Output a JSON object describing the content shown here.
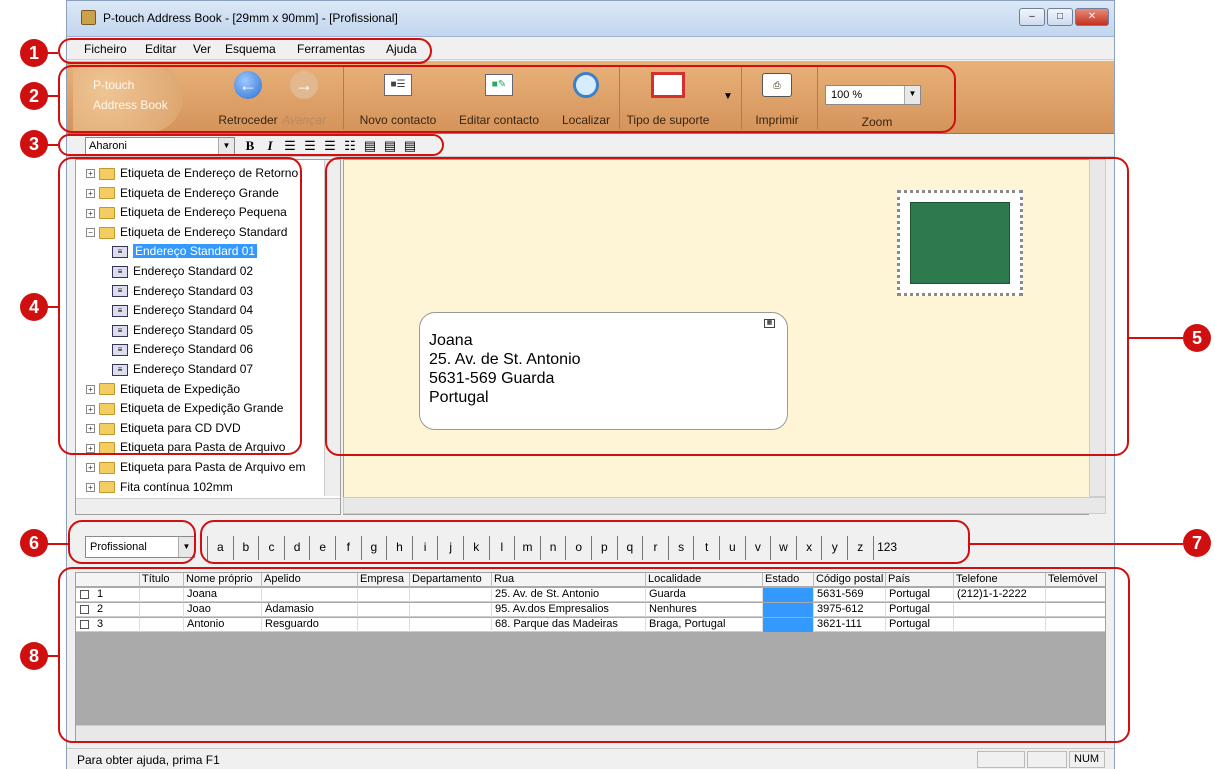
{
  "window": {
    "title": "P-touch Address Book - [29mm x 90mm] - [Profissional]",
    "controls": {
      "minimize": "‒",
      "maximize": "□",
      "close": "✕"
    }
  },
  "menu": [
    "Ficheiro",
    "Editar",
    "Ver",
    "Esquema",
    "Ferramentas",
    "Ajuda"
  ],
  "toolbar": {
    "logo_line1": "P-touch",
    "logo_line2": "Address Book",
    "back": "Retroceder",
    "forward": "Avançar",
    "new_contact": "Novo contacto",
    "edit_contact": "Editar contacto",
    "find": "Localizar",
    "media_type": "Tipo de suporte",
    "print": "Imprimir",
    "zoom_label": "Zoom",
    "zoom_value": "100 %"
  },
  "format_bar": {
    "font": "Aharoni",
    "bold": "B",
    "italic": "I"
  },
  "tree": {
    "items": [
      "Etiqueta de Endereço de Retorno",
      "Etiqueta de Endereço Grande",
      "Etiqueta de Endereço Pequena",
      "Etiqueta de Endereço Standard",
      "Endereço Standard 01",
      "Endereço Standard 02",
      "Endereço Standard 03",
      "Endereço Standard 04",
      "Endereço Standard 05",
      "Endereço Standard 06",
      "Endereço Standard 07",
      "Etiqueta de Expedição",
      "Etiqueta de Expedição Grande",
      "Etiqueta para CD DVD",
      "Etiqueta para Pasta de Arquivo",
      "Etiqueta para Pasta de Arquivo em",
      "Fita contínua 102mm"
    ],
    "selected": "Endereço Standard 01"
  },
  "preview": {
    "address_lines": [
      "Joana",
      "25. Av. de St. Antonio",
      "5631-569 Guarda",
      "Portugal"
    ]
  },
  "category": "Profissional",
  "alphabet": [
    "a",
    "b",
    "c",
    "d",
    "e",
    "f",
    "g",
    "h",
    "i",
    "j",
    "k",
    "l",
    "m",
    "n",
    "o",
    "p",
    "q",
    "r",
    "s",
    "t",
    "u",
    "v",
    "w",
    "x",
    "y",
    "z",
    "123"
  ],
  "table": {
    "columns": [
      "Título",
      "Nome próprio",
      "Apelido",
      "Empresa",
      "Departamento",
      "Rua",
      "Localidade",
      "Estado",
      "Código postal",
      "País",
      "Telefone",
      "Telemóvel"
    ],
    "rows": [
      {
        "num": "1",
        "titulo": "",
        "nome": "Joana",
        "apelido": "",
        "empresa": "",
        "departamento": "",
        "rua": "25. Av. de St. Antonio",
        "localidade": "Guarda",
        "estado": "",
        "codigo": "5631-569",
        "pais": "Portugal",
        "telefone": "(212)1-1-2222",
        "telemovel": ""
      },
      {
        "num": "2",
        "titulo": "",
        "nome": "Joao",
        "apelido": "Ádamasio",
        "empresa": "",
        "departamento": "",
        "rua": "95. Av.dos Empresalios",
        "localidade": "Nenhures",
        "estado": "",
        "codigo": "3975-612",
        "pais": "Portugal",
        "telefone": "",
        "telemovel": ""
      },
      {
        "num": "3",
        "titulo": "",
        "nome": "Antonio",
        "apelido": "Resguardo",
        "empresa": "",
        "departamento": "",
        "rua": "68. Parque das Madeiras",
        "localidade": "Braga, Portugal",
        "estado": "",
        "codigo": "3621-111",
        "pais": "Portugal",
        "telefone": "",
        "telemovel": ""
      }
    ]
  },
  "status": {
    "help": "Para obter ajuda, prima F1",
    "num": "NUM"
  },
  "callouts": [
    "1",
    "2",
    "3",
    "4",
    "5",
    "6",
    "7",
    "8"
  ],
  "colors": {
    "callout": "#d01010",
    "toolbar": "#dba26c",
    "selection": "#3399ff",
    "stamp": "#2e7a4e",
    "paper": "#fdf5d6"
  }
}
